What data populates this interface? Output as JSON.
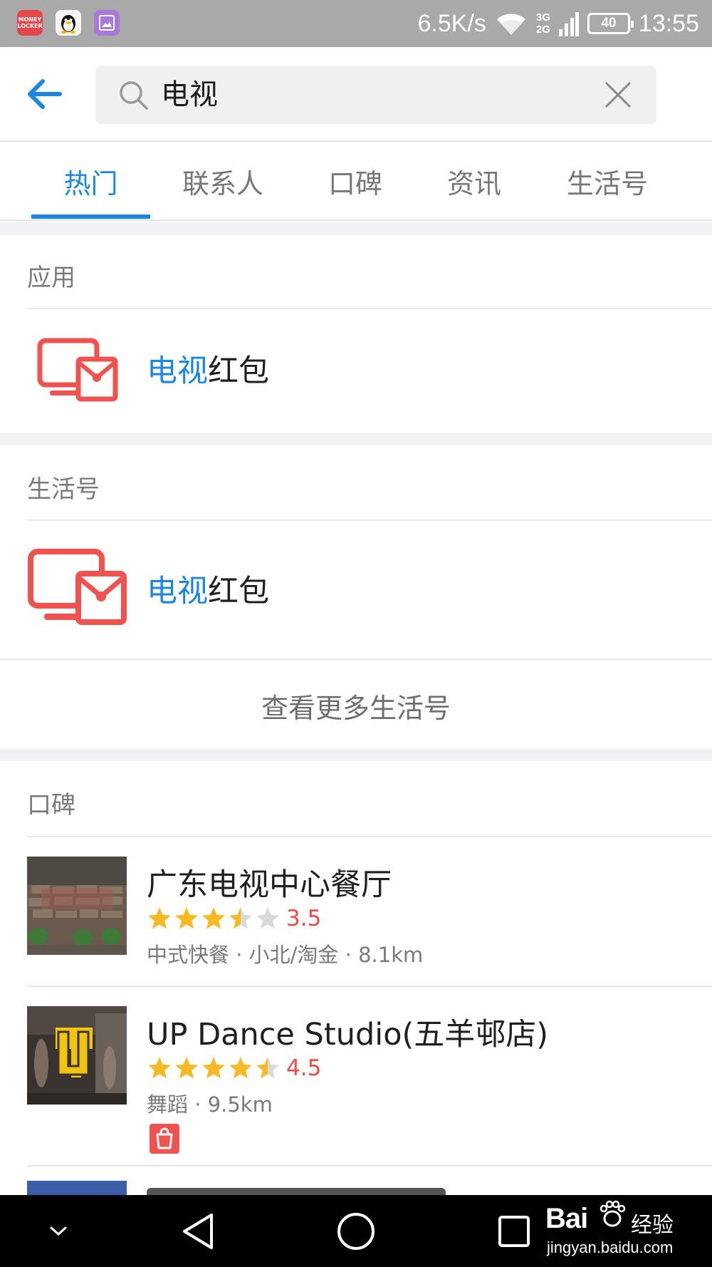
{
  "status_bar": {
    "net_speed": "6.5K/s",
    "network_3g": "3G",
    "network_2g": "2G",
    "battery": "40",
    "time": "13:55",
    "notification_apps": [
      "money-locker-icon",
      "qq-icon",
      "gallery-icon"
    ],
    "money_locker_label": "MONEY LOCKER"
  },
  "search": {
    "query": "电视"
  },
  "tabs": [
    {
      "label": "热门",
      "active": true
    },
    {
      "label": "联系人",
      "active": false
    },
    {
      "label": "口碑",
      "active": false
    },
    {
      "label": "资讯",
      "active": false
    },
    {
      "label": "生活号",
      "active": false
    }
  ],
  "apps_section": {
    "title": "应用",
    "item": {
      "highlight": "电视",
      "rest": "红包",
      "icon": "tv-red-envelope-icon"
    }
  },
  "life_section": {
    "title": "生活号",
    "item": {
      "highlight": "电视",
      "rest": "红包",
      "icon": "tv-red-envelope-icon"
    },
    "more_label": "查看更多生活号"
  },
  "koubei_section": {
    "title": "口碑",
    "items": [
      {
        "name": "广东电视中心餐厅",
        "rating": "3.5",
        "stars": 3.5,
        "meta": "中式快餐 · 小北/淘金 · 8.1km"
      },
      {
        "name": "UP Dance Studio(五羊邨店)",
        "rating": "4.5",
        "stars": 4.5,
        "meta": "舞蹈 · 9.5km",
        "badge": "shopping-bag-icon"
      }
    ]
  },
  "colors": {
    "accent": "#1c87e2",
    "icon_red": "#ef5350",
    "star_gold": "#f7b924",
    "rating_red": "#ef4a4a"
  },
  "watermark": {
    "logo": "Bai",
    "cn": "经验",
    "url": "jingyan.baidu.com"
  }
}
